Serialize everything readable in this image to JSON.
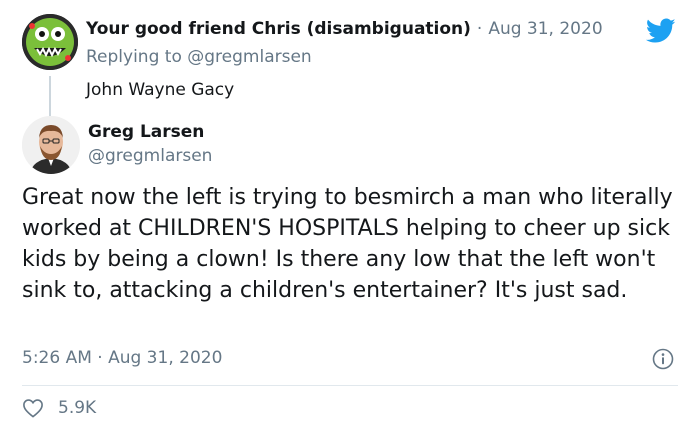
{
  "reply_tweet": {
    "author_name": "Your good friend Chris (disambiguation)",
    "separator": "·",
    "date": "Aug 31, 2020",
    "replying_prefix": "Replying to",
    "replying_handle": "@gregmlarsen",
    "text": "John Wayne Gacy"
  },
  "main_tweet": {
    "author_name": "Greg Larsen",
    "author_handle": "@gregmlarsen",
    "text": "Great now the left is trying to besmirch a man who literally worked at CHILDREN'S HOSPITALS helping to cheer up sick kids by being a clown! Is there any low that the left won't sink to, attacking a children's entertainer? It's just sad.",
    "timestamp": "5:26 AM · Aug 31, 2020",
    "likes": "5.9K"
  },
  "icons": {
    "brand": "twitter-bird-icon",
    "info": "info-icon",
    "like": "heart-icon"
  },
  "colors": {
    "twitter_blue": "#1da1f2",
    "secondary_text": "#657786",
    "primary_text": "#14171a"
  }
}
